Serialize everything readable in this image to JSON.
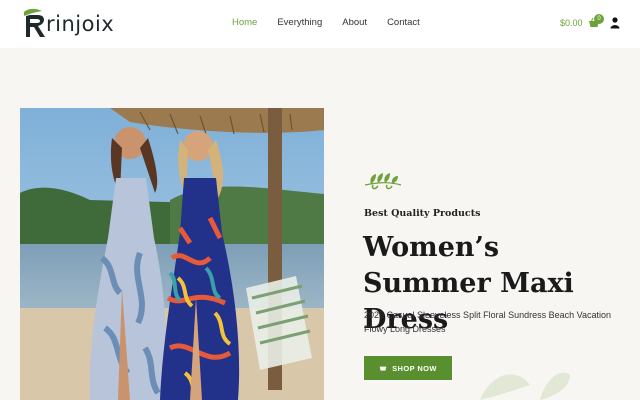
{
  "brand": {
    "name": "rinjoix",
    "accent": "#6ea33c"
  },
  "nav": {
    "items": [
      "Home",
      "Everything",
      "About",
      "Contact"
    ],
    "active_index": 0
  },
  "cart": {
    "total": "$0.00",
    "count": "0"
  },
  "hero": {
    "eyebrow": "Best Quality Products",
    "title": "Women’s Summer Maxi Dress",
    "description": "2025 Casual Sleeveless Split Floral Sundress Beach Vacation Flowy Long Dresses",
    "button_label": "SHOP NOW"
  },
  "icons": {
    "cart": "basket-icon",
    "user": "user-icon",
    "button": "cart-icon",
    "decoration": "leaf-icon"
  }
}
